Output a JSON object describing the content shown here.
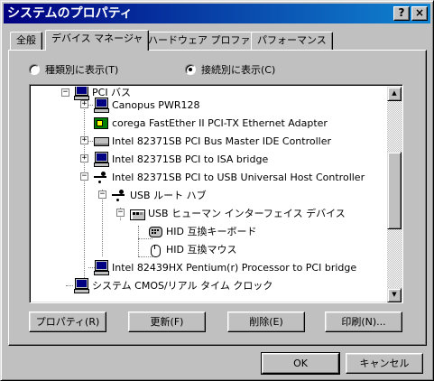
{
  "window": {
    "title": "システムのプロパティ",
    "help_button": "?",
    "close_button": "×"
  },
  "tabs": [
    {
      "label": "全般",
      "active": false
    },
    {
      "label": "デバイス マネージャ",
      "active": true
    },
    {
      "label": "ハードウェア プロファイル",
      "active": false
    },
    {
      "label": "パフォーマンス",
      "active": false
    }
  ],
  "view_options": {
    "by_type": {
      "label": "種類別に表示(T)",
      "checked": false
    },
    "by_connection": {
      "label": "接続別に表示(C)",
      "checked": true
    }
  },
  "tree": {
    "items": [
      {
        "label": "PCI バス",
        "icon": "monitor-icon",
        "expander": "−"
      },
      {
        "label": "Canopus PWR128",
        "icon": "monitor-icon",
        "expander": "+"
      },
      {
        "label": "corega FastEther II PCI-TX Ethernet Adapter",
        "icon": "network-card-icon",
        "expander": ""
      },
      {
        "label": "Intel 82371SB PCI Bus Master IDE Controller",
        "icon": "drive-controller-icon",
        "expander": "+"
      },
      {
        "label": "Intel 82371SB PCI to ISA bridge",
        "icon": "monitor-icon",
        "expander": "+"
      },
      {
        "label": "Intel 82371SB PCI to USB Universal Host Controller",
        "icon": "usb-icon",
        "expander": "−"
      },
      {
        "label": "USB ルート ハブ",
        "icon": "usb-icon",
        "expander": "−"
      },
      {
        "label": "USB ヒューマン インターフェイス デバイス",
        "icon": "hid-device-icon",
        "expander": "−"
      },
      {
        "label": "HID 互換キーボード",
        "icon": "keyboard-icon",
        "expander": ""
      },
      {
        "label": "HID 互換マウス",
        "icon": "mouse-icon",
        "expander": ""
      },
      {
        "label": "Intel 82439HX Pentium(r) Processor to PCI bridge",
        "icon": "monitor-icon",
        "expander": ""
      },
      {
        "label": "システム CMOS/リアル タイム クロック",
        "icon": "monitor-icon",
        "expander": ""
      }
    ]
  },
  "panel_buttons": {
    "properties": "プロパティ(R)",
    "refresh": "更新(F)",
    "remove": "削除(E)",
    "print": "印刷(N)..."
  },
  "dialog_buttons": {
    "ok": "OK",
    "cancel": "キャンセル"
  }
}
